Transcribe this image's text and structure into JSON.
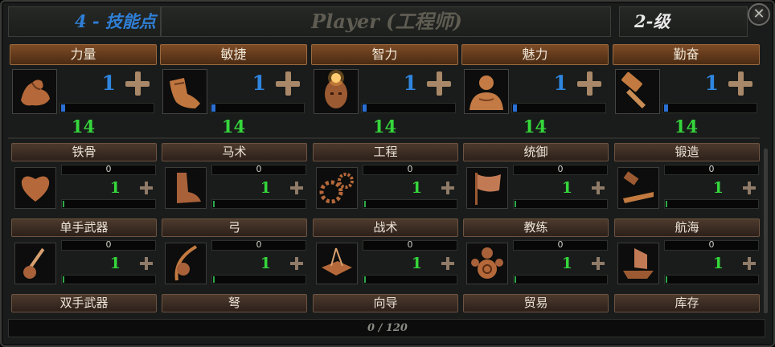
{
  "header": {
    "skill_points": "4 - 技能点",
    "player_title": "Player (工程师)",
    "level": "2-级",
    "close_symbol": "✕"
  },
  "attributes": [
    {
      "label": "力量",
      "value": "1",
      "total": "14",
      "icon": "muscle-arm-icon",
      "progress": 0.04
    },
    {
      "label": "敏捷",
      "value": "1",
      "total": "14",
      "icon": "boot-icon",
      "progress": 0.04
    },
    {
      "label": "智力",
      "value": "1",
      "total": "14",
      "icon": "glowing-head-icon",
      "progress": 0.04
    },
    {
      "label": "魅力",
      "value": "1",
      "total": "14",
      "icon": "bust-figure-icon",
      "progress": 0.04
    },
    {
      "label": "勤奋",
      "value": "1",
      "total": "14",
      "icon": "hammer-icon",
      "progress": 0.04
    }
  ],
  "skills": [
    {
      "label": "铁骨",
      "xp": "0",
      "value": "1",
      "icon": "heart-icon"
    },
    {
      "label": "马术",
      "xp": "0",
      "value": "1",
      "icon": "riding-boot-icon"
    },
    {
      "label": "工程",
      "xp": "0",
      "value": "1",
      "icon": "gears-icon"
    },
    {
      "label": "统御",
      "xp": "0",
      "value": "1",
      "icon": "banner-flag-icon"
    },
    {
      "label": "锻造",
      "xp": "0",
      "value": "1",
      "icon": "anvil-hammer-icon"
    },
    {
      "label": "单手武器",
      "xp": "0",
      "value": "1",
      "icon": "sword-hand-icon"
    },
    {
      "label": "弓",
      "xp": "0",
      "value": "1",
      "icon": "bow-hand-icon"
    },
    {
      "label": "战术",
      "xp": "0",
      "value": "1",
      "icon": "map-compass-icon"
    },
    {
      "label": "教练",
      "xp": "0",
      "value": "1",
      "icon": "training-dummy-icon"
    },
    {
      "label": "航海",
      "xp": "0",
      "value": "1",
      "icon": "ship-icon"
    }
  ],
  "partial_skills": [
    "双手武器",
    "弩",
    "向导",
    "贸易",
    "库存"
  ],
  "footer": {
    "points": "0 / 120"
  },
  "colors": {
    "attr_value": "#2f86e0",
    "skill_value": "#35d63b",
    "header_blue": "#2f7fd6"
  }
}
